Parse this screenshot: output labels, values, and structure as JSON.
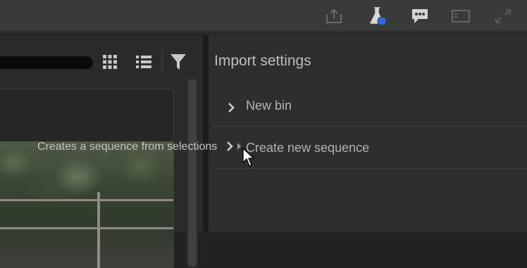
{
  "toolbar": {
    "icons": [
      "share-icon",
      "flask-icon",
      "chat-bubble-icon",
      "panel-icon",
      "fullscreen-icon"
    ],
    "accent_color": "#2d6ce0"
  },
  "media_browser": {
    "view_buttons": [
      "grid-view-icon",
      "list-view-icon",
      "filter-icon"
    ],
    "tooltip": "Creates a sequence from selections"
  },
  "import_settings": {
    "title": "Import settings",
    "items": [
      {
        "label": "New bin"
      },
      {
        "label": "Create new sequence"
      }
    ]
  }
}
